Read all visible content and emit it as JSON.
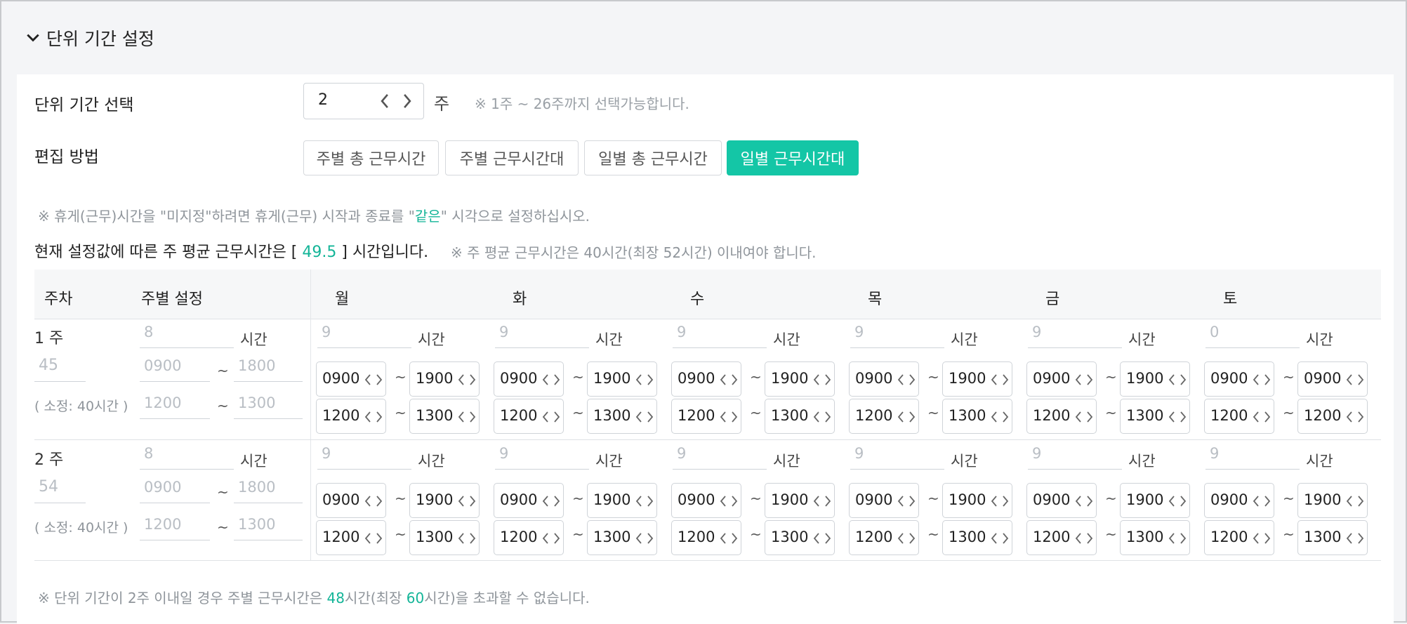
{
  "section": {
    "title": "단위 기간 설정"
  },
  "period": {
    "label": "단위 기간 선택",
    "value": "2",
    "unit": "주",
    "hint": "※ 1주 ~ 26주까지 선택가능합니다."
  },
  "edit": {
    "label": "편집 방법",
    "buttons": [
      "주별 총 근무시간",
      "주별 근무시간대",
      "일별 총 근무시간",
      "일별 근무시간대"
    ],
    "active_index": 3
  },
  "notes": {
    "rest_prefix": "※  휴게(근무)시간을 \"미지정\"하려면 휴게(근무) 시작과 종료를 \"",
    "rest_highlight": "같은",
    "rest_suffix": "\" 시각으로 설정하십시오.",
    "avg_prefix": "현재 설정값에 따른 주 평균 근무시간은 [ ",
    "avg_value": "49.5",
    "avg_suffix": " ] 시간입니다.",
    "avg_limit": "※  주 평균 근무시간은 40시간(최장 52시간) 이내여야 합니다.",
    "foot_prefix": "※ 단위 기간이 2주 이내일 경우 주별 근무시간은 ",
    "foot_val1": "48",
    "foot_mid": "시간(최장 ",
    "foot_val2": "60",
    "foot_suffix": "시간)을 초과할 수 없습니다."
  },
  "table": {
    "headers": {
      "week": "주차",
      "weekly": "주별 설정"
    },
    "days": [
      "월",
      "화",
      "수",
      "목",
      "금",
      "토"
    ],
    "hours_unit": "시간",
    "tilde": "~",
    "weeks": [
      {
        "label": "1 주",
        "total": "45",
        "standard": "( 소정: 40시간 )",
        "weekly_hours": "8",
        "work_start": "0900",
        "work_end": "1800",
        "rest_start": "1200",
        "rest_end": "1300",
        "days": [
          {
            "hours": "9",
            "ws": "0900",
            "we": "1900",
            "rs": "1200",
            "re": "1300"
          },
          {
            "hours": "9",
            "ws": "0900",
            "we": "1900",
            "rs": "1200",
            "re": "1300"
          },
          {
            "hours": "9",
            "ws": "0900",
            "we": "1900",
            "rs": "1200",
            "re": "1300"
          },
          {
            "hours": "9",
            "ws": "0900",
            "we": "1900",
            "rs": "1200",
            "re": "1300"
          },
          {
            "hours": "9",
            "ws": "0900",
            "we": "1900",
            "rs": "1200",
            "re": "1300"
          },
          {
            "hours": "0",
            "ws": "0900",
            "we": "0900",
            "rs": "1200",
            "re": "1200"
          }
        ]
      },
      {
        "label": "2 주",
        "total": "54",
        "standard": "( 소정: 40시간 )",
        "weekly_hours": "8",
        "work_start": "0900",
        "work_end": "1800",
        "rest_start": "1200",
        "rest_end": "1300",
        "days": [
          {
            "hours": "9",
            "ws": "0900",
            "we": "1900",
            "rs": "1200",
            "re": "1300"
          },
          {
            "hours": "9",
            "ws": "0900",
            "we": "1900",
            "rs": "1200",
            "re": "1300"
          },
          {
            "hours": "9",
            "ws": "0900",
            "we": "1900",
            "rs": "1200",
            "re": "1300"
          },
          {
            "hours": "9",
            "ws": "0900",
            "we": "1900",
            "rs": "1200",
            "re": "1300"
          },
          {
            "hours": "9",
            "ws": "0900",
            "we": "1900",
            "rs": "1200",
            "re": "1300"
          },
          {
            "hours": "9",
            "ws": "0900",
            "we": "1900",
            "rs": "1200",
            "re": "1300"
          }
        ]
      }
    ]
  },
  "colors": {
    "accent": "#14c6a6",
    "accent_text": "#14b598"
  },
  "icons": {
    "collapse": "chevron-down-icon",
    "prev": "chevron-left-icon",
    "next": "chevron-right-icon"
  }
}
